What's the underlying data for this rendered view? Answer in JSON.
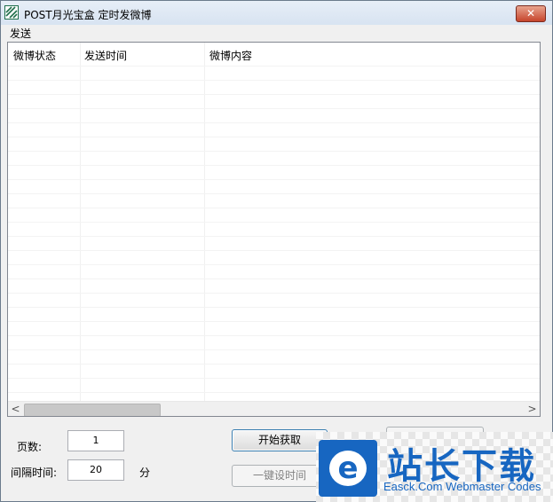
{
  "window": {
    "title": "POST月光宝盒 定时发微博",
    "close_symbol": "✕"
  },
  "menu": {
    "items": [
      {
        "label": "发送"
      }
    ]
  },
  "grid": {
    "columns": [
      {
        "label": "微博状态"
      },
      {
        "label": "发送时间"
      },
      {
        "label": "微博内容"
      }
    ],
    "scroll_left_symbol": "<",
    "scroll_right_symbol": ">"
  },
  "form": {
    "pages_label": "页数:",
    "pages_value": "1",
    "interval_label": "间隔时间:",
    "interval_value": "20",
    "interval_unit": "分"
  },
  "buttons": {
    "start_fetch": "开始获取",
    "set_time_all": "一键设时间"
  },
  "watermark": {
    "logo_letter": "e",
    "text": "站长下载",
    "subtext": "Easck.Com Webmaster Codes"
  }
}
